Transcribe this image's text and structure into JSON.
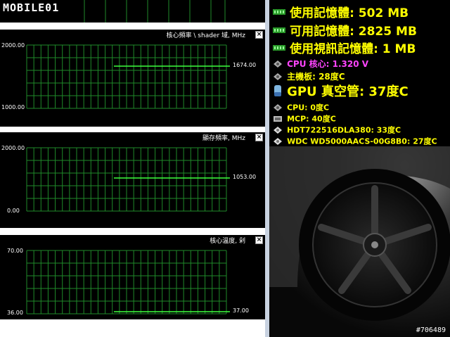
{
  "logo": {
    "text": "MOBILE01"
  },
  "panels": [
    {
      "title": "核心頻率 \\ shader 域, MHz",
      "y_top": "2000.00",
      "y_bottom": "1000.00",
      "value": "1674.00"
    },
    {
      "title": "顯存頻率, MHz",
      "y_top": "2000.00",
      "y_bottom": "0.00",
      "value": "1053.00"
    },
    {
      "title": "核心溫度, 剁",
      "y_top": "70.00",
      "y_bottom": "36.00",
      "value": "37.00"
    }
  ],
  "sensors": {
    "mem_used": "使用記憶體: 502 MB",
    "mem_free": "可用記憶體: 2825 MB",
    "vram_used": "使用視訊記憶體: 1 MB",
    "cpu_core": "CPU 核心: 1.320 V",
    "motherboard": "主機板: 28度C",
    "gpu_vac": "GPU 真空管: 37度C",
    "cpu_temp": "CPU: 0度C",
    "mcp": "MCP: 40度C",
    "hdd1": "HDT722516DLA380: 33度C",
    "hdd2": "WDC WD5000AACS-00G8B0: 27度C"
  },
  "watermark": "#706489",
  "colors": {
    "grid": "#1f8a2a",
    "line": "#3dff3d",
    "mem_text": "#ffff00",
    "cpu_text": "#ff44ff",
    "sensor_text": "#ffff00"
  }
}
